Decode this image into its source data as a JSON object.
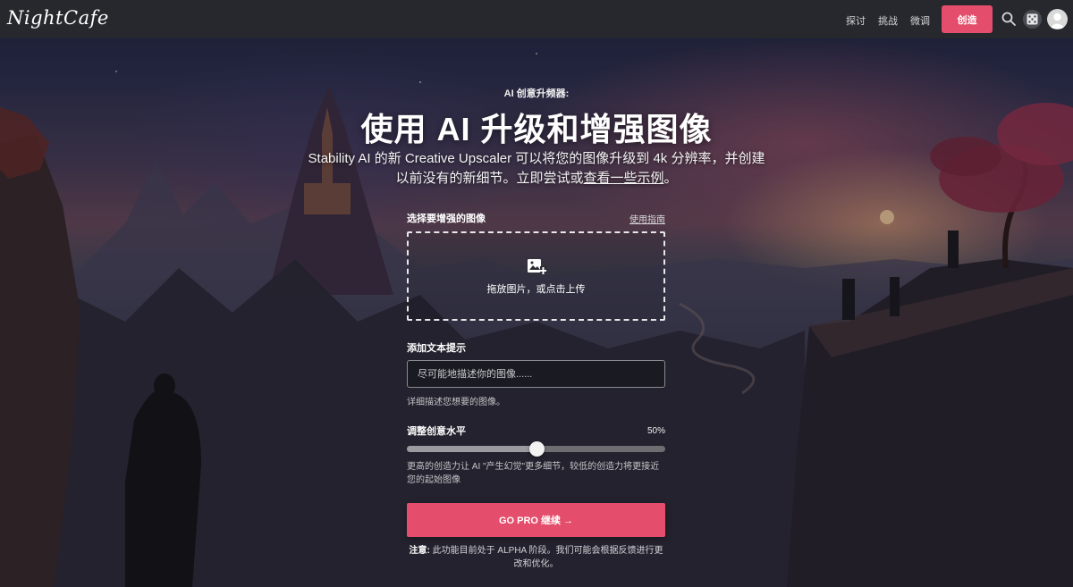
{
  "brand": {
    "logo_text": "NightCafe"
  },
  "nav": {
    "links": [
      "探讨",
      "挑战",
      "微调"
    ],
    "create_label": "创造",
    "icons": [
      "search-icon",
      "dice-icon",
      "avatar"
    ],
    "accent_color": "#e44d6b"
  },
  "hero": {
    "eyebrow": "AI 创意升频器:",
    "title": "使用 AI 升级和增强图像",
    "subtitle_before": "Stability AI 的新 Creative Upscaler 可以将您的图像升级到 4k 分辨率，并创建以前没有的新细节。立即尝试或",
    "subtitle_link": "查看一些示例",
    "subtitle_after": "。"
  },
  "upload": {
    "label": "选择要增强的图像",
    "guide_link": "使用指南",
    "dropzone_text": "拖放图片，或点击上传"
  },
  "prompt": {
    "label": "添加文本提示",
    "placeholder": "尽可能地描述你的图像......",
    "hint": "详细描述您想要的图像。"
  },
  "creativity": {
    "label": "调整创意水平",
    "value_text": "50%",
    "value": 0.5,
    "description": "更高的创造力让 AI \"产生幻觉\"更多细节，较低的创造力将更接近您的起始图像"
  },
  "cta": {
    "label": "GO PRO 继续 →"
  },
  "note": {
    "bold": "注意:",
    "text": "此功能目前处于 ALPHA 阶段。我们可能会根据反馈进行更改和优化。"
  }
}
